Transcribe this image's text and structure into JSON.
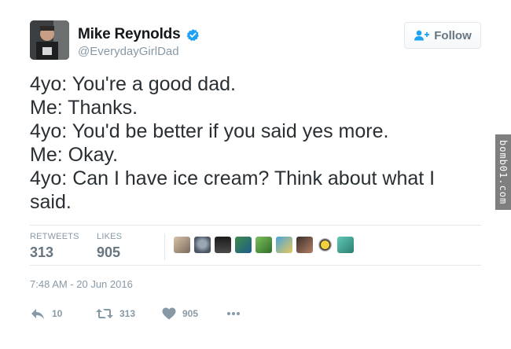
{
  "user": {
    "display_name": "Mike Reynolds",
    "handle": "@EverydayGirlDad",
    "verified_icon": "verified-badge-icon"
  },
  "follow_button": {
    "label": "Follow",
    "icon": "add-user-icon"
  },
  "tweet": {
    "lines": [
      "4yo: You're a good dad.",
      "Me: Thanks.",
      "4yo: You'd be better if you said yes more.",
      "Me: Okay.",
      "4yo: Can I have ice cream? Think about what I",
      "said."
    ]
  },
  "stats": {
    "retweets_label": "RETWEETS",
    "retweets_value": "313",
    "likes_label": "LIKES",
    "likes_value": "905"
  },
  "timestamp": "7:48 AM - 20 Jun 2016",
  "actions": {
    "reply_count": "10",
    "retweet_count": "313",
    "like_count": "905",
    "more_icon": "more-dots-icon"
  },
  "watermark": "bomb01.com",
  "colors": {
    "link_blue": "#1da1f2",
    "muted": "#8899a6",
    "text": "#292f33"
  }
}
